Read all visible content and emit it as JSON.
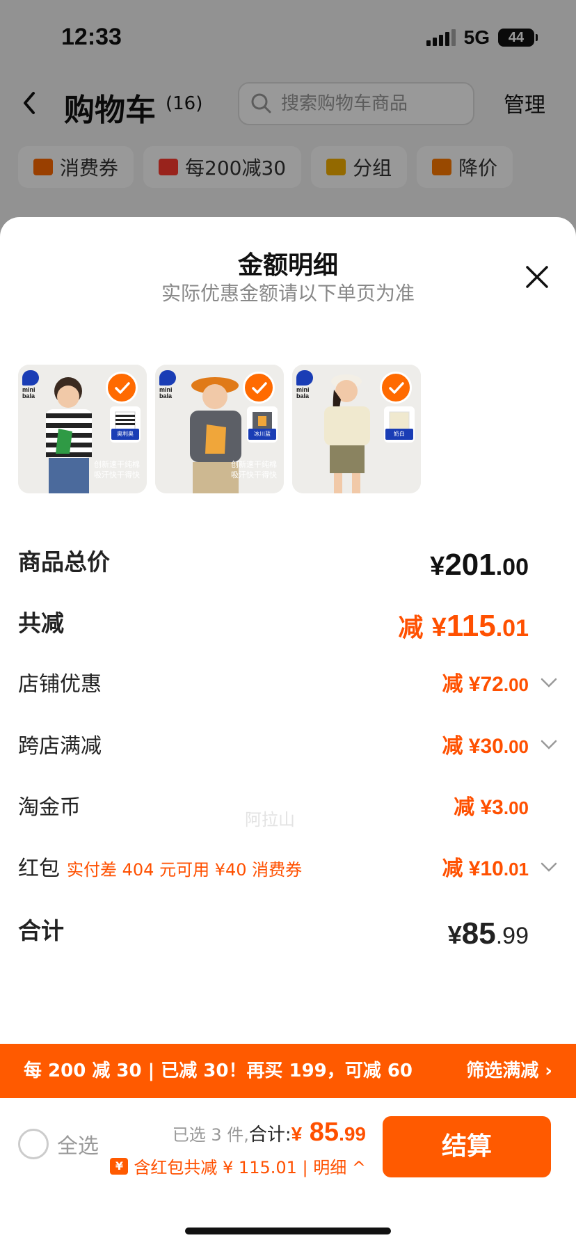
{
  "status_bar": {
    "time": "12:33",
    "network": "5G",
    "battery": "44"
  },
  "nav": {
    "title": "购物车",
    "count": "(16)",
    "search_placeholder": "搜索购物车商品",
    "manage": "管理"
  },
  "chips": [
    {
      "label": "消费券",
      "icon": "coupon-icon",
      "color": "#ff6a00"
    },
    {
      "label": "每200减30",
      "icon": "gift-box-icon",
      "color": "#ff3b30"
    },
    {
      "label": "分组",
      "icon": "folder-icon",
      "color": "#f5b000"
    },
    {
      "label": "降价",
      "icon": "price-drop-icon",
      "color": "#ff7a00"
    }
  ],
  "sheet": {
    "title": "金额明细",
    "subtitle": "实际优惠金额请以下单页为准",
    "products": [
      {
        "tag": "奥利奥",
        "caption": "创新速干纯棉 吸汗快干得快"
      },
      {
        "tag": "冰川蓝",
        "caption": "创新速干纯棉 吸汗快干得快"
      },
      {
        "tag": "奶白",
        "caption": ""
      }
    ],
    "brand_logo_text": "mini bala",
    "watermark": "阿拉山",
    "rows": {
      "total": {
        "label": "商品总价",
        "yen": "¥",
        "int": "201",
        "cents": ".00"
      },
      "discount": {
        "label": "共减",
        "prefix": "减",
        "yen": "¥",
        "int": "115",
        "cents": ".01"
      },
      "store": {
        "label": "店铺优惠",
        "value_main": "减 ¥72",
        "value_cents": ".00"
      },
      "cross_store": {
        "label": "跨店满减",
        "value_main": "减 ¥30",
        "value_cents": ".00"
      },
      "gold_coins": {
        "label": "淘金币",
        "value_main": "减 ¥3",
        "value_cents": ".00"
      },
      "red_packet": {
        "label": "红包",
        "note": "实付差 404 元可用 ¥40 消费券",
        "value_main": "减 ¥10",
        "value_cents": ".01"
      },
      "sum": {
        "label": "合计",
        "yen": "¥",
        "int": "85",
        "cents": ".99"
      }
    }
  },
  "promo": {
    "text": "每 200 减 30 | 已减 30！再买 199，可减 60",
    "link": "筛选满减 ›"
  },
  "bottom": {
    "select_all": "全选",
    "selected_text": "已选 3 件,",
    "total_label": "合计:",
    "price_yen": "¥",
    "price_int": " 85",
    "price_cents": ".99",
    "discount_text": "含红包共减 ¥ 115.01 | 明细 ^",
    "checkout": "结算"
  },
  "colors": {
    "accent": "#ff5a00",
    "discount_text": "#ff5000",
    "brand_blue": "#1a3db5"
  }
}
